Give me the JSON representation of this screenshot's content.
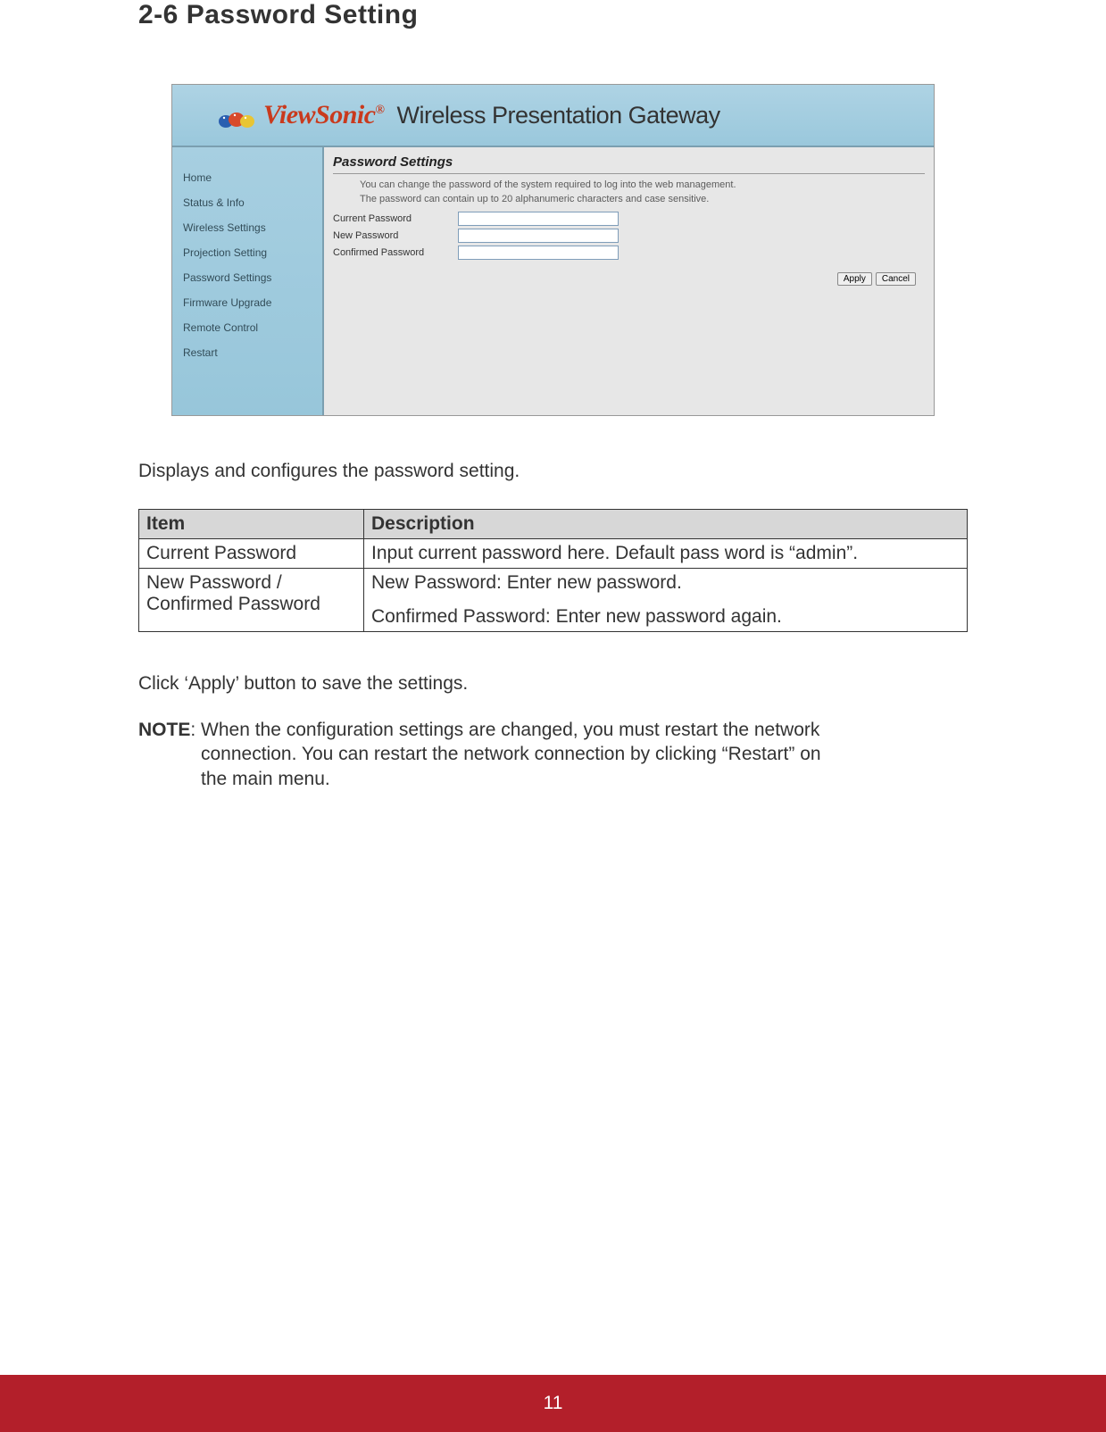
{
  "section_title": "2-6 Password Setting",
  "screenshot": {
    "brand": "ViewSonic",
    "banner_title": "Wireless Presentation Gateway",
    "sidebar": {
      "items": [
        {
          "label": "Home"
        },
        {
          "label": "Status & Info"
        },
        {
          "label": "Wireless Settings"
        },
        {
          "label": "Projection Setting"
        },
        {
          "label": "Password Settings"
        },
        {
          "label": "Firmware Upgrade"
        },
        {
          "label": "Remote Control"
        },
        {
          "label": "Restart"
        }
      ]
    },
    "content": {
      "title": "Password Settings",
      "info1": "You can change the password of the system required to log into the web management.",
      "info2": "The password can contain up to 20 alphanumeric characters and case sensitive.",
      "fields": {
        "current": "Current Password",
        "new": "New Password",
        "confirm": "Confirmed Password"
      },
      "buttons": {
        "apply": "Apply",
        "cancel": "Cancel"
      }
    }
  },
  "intro_text": "Displays and configures the password setting.",
  "table": {
    "headers": {
      "item": "Item",
      "desc": "Description"
    },
    "rows": [
      {
        "item": "Current Password",
        "desc": "Input current password here. Default pass word is “admin”."
      },
      {
        "item": "New Password / Confirmed Password",
        "desc_line1": "New Password: Enter new password.",
        "desc_line2": "Confirmed Password: Enter new password again."
      }
    ]
  },
  "apply_text": "Click ‘Apply’ button to save the settings.",
  "note": {
    "label": "NOTE",
    "line1": ": When the configuration settings are changed, you must restart the network",
    "line2": "connection. You can restart the network connection by clicking “Restart” on",
    "line3": "the main menu."
  },
  "page_number": "11"
}
